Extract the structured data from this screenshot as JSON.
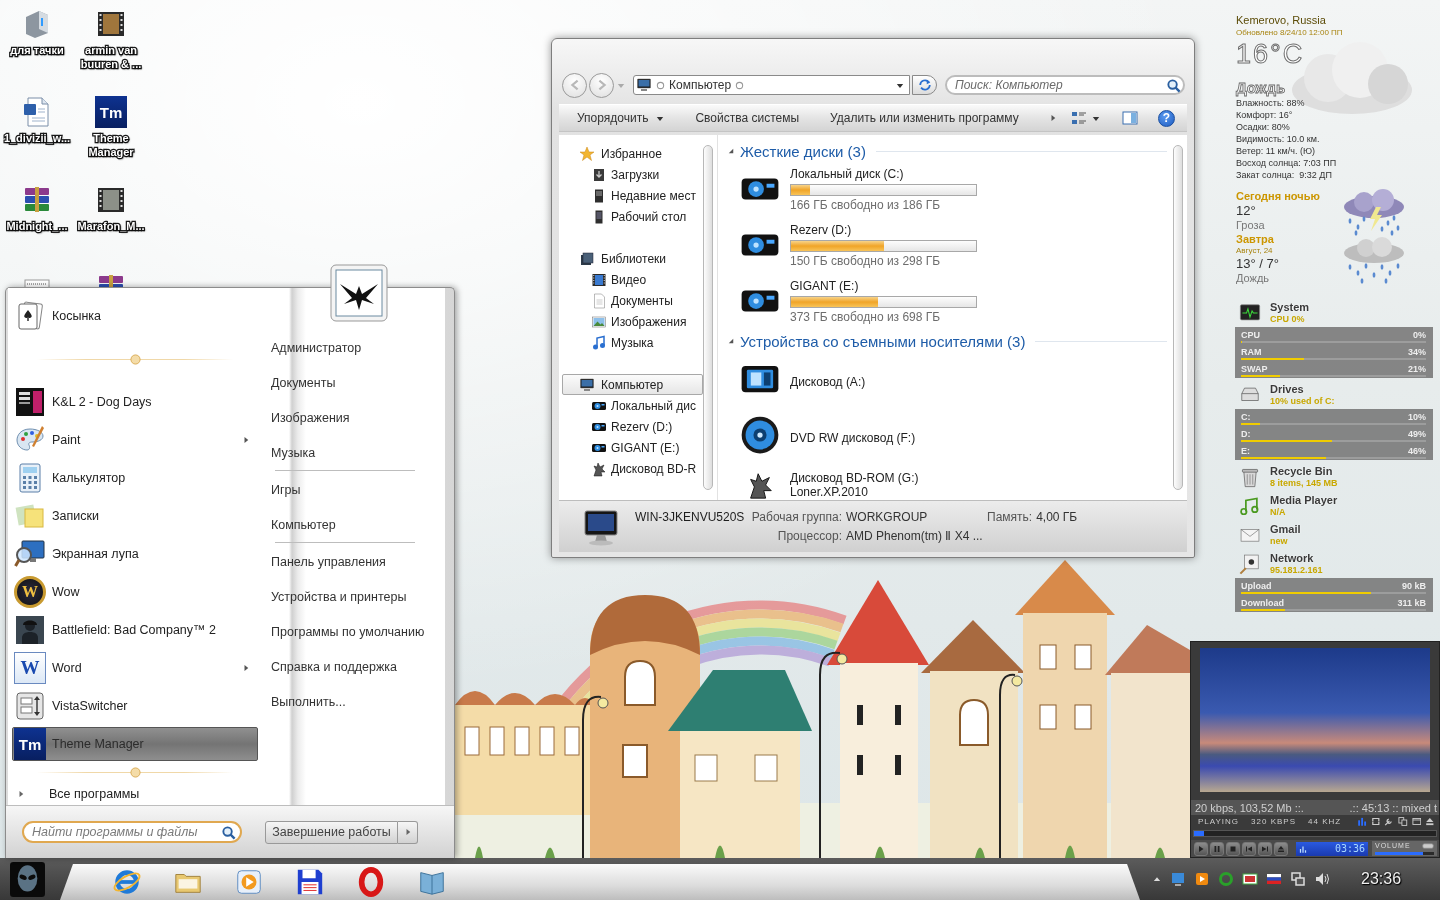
{
  "desktop_icons": [
    {
      "label": "для тачки",
      "kind": "device"
    },
    {
      "label": "1_divizii_w...",
      "kind": "document"
    },
    {
      "label": "Midnight_...",
      "kind": "archive"
    },
    {
      "kind": "textdoc"
    },
    {
      "label": "armin van buuren & ...",
      "kind": "film"
    },
    {
      "label": "Theme Manager",
      "kind": "tm",
      "icon_text": "Tm"
    },
    {
      "label": "Marafon_M...",
      "kind": "film2"
    },
    {
      "kind": "archive"
    }
  ],
  "start_menu": {
    "pinned": [
      {
        "label": "Косынка",
        "kind": "cards"
      }
    ],
    "recent": [
      {
        "label": "K&L 2 - Dog Days",
        "kind": "cover",
        "submenu": false,
        "selected": false
      },
      {
        "label": "Paint",
        "kind": "paint",
        "submenu": true,
        "selected": false
      },
      {
        "label": "Калькулятор",
        "kind": "calc",
        "submenu": false,
        "selected": false
      },
      {
        "label": "Записки",
        "kind": "notes",
        "submenu": false,
        "selected": false
      },
      {
        "label": "Экранная лупа",
        "kind": "magnifier",
        "submenu": false,
        "selected": false
      },
      {
        "label": "Wow",
        "kind": "wow",
        "icon_text": "W",
        "submenu": false,
        "selected": false
      },
      {
        "label": "Battlefield: Bad Company™ 2",
        "kind": "soldier",
        "submenu": false,
        "selected": false
      },
      {
        "label": "Word",
        "kind": "word",
        "icon_text": "W",
        "submenu": true,
        "selected": false
      },
      {
        "label": "VistaSwitcher",
        "kind": "switcher",
        "submenu": false,
        "selected": false
      },
      {
        "label": "Theme Manager",
        "kind": "tm",
        "icon_text": "Tm",
        "submenu": false,
        "selected": true
      }
    ],
    "all_programs": "Все программы",
    "search": {
      "placeholder": "Найти программы и файлы"
    },
    "shutdown": "Завершение работы",
    "places": [
      [
        "Администратор",
        "Документы",
        "Изображения",
        "Музыка"
      ],
      [
        "Игры",
        "Компьютер"
      ],
      [
        "Панель управления",
        "Устройства и принтеры",
        "Программы по умолчанию",
        "Справка и поддержка",
        "Выполнить..."
      ]
    ]
  },
  "explorer": {
    "address": "Компьютер",
    "search": {
      "placeholder": "Поиск: Компьютер"
    },
    "toolbar": [
      {
        "label": "Упорядочить",
        "dropdown": true
      },
      {
        "label": "Свойства системы",
        "dropdown": false
      },
      {
        "label": "Удалить или изменить программу",
        "dropdown": false
      }
    ],
    "help": "?",
    "nav": [
      {
        "label": "Избранное",
        "kind": "star",
        "selected": false,
        "children": [
          {
            "label": "Загрузки",
            "kind": "download",
            "selected": false
          },
          {
            "label": "Недавние мест",
            "kind": "recent",
            "selected": false
          },
          {
            "label": "Рабочий стол",
            "kind": "desktop",
            "selected": false
          }
        ]
      },
      {
        "label": "Библиотеки",
        "kind": "library",
        "selected": false,
        "children": [
          {
            "label": "Видео",
            "kind": "video",
            "selected": false
          },
          {
            "label": "Документы",
            "kind": "docs",
            "selected": false
          },
          {
            "label": "Изображения",
            "kind": "pictures",
            "selected": false
          },
          {
            "label": "Музыка",
            "kind": "music",
            "selected": false
          }
        ]
      },
      {
        "label": "Компьютер",
        "kind": "computer",
        "selected": true,
        "children": [
          {
            "label": "Локальный дис",
            "kind": "hdd",
            "selected": false
          },
          {
            "label": "Rezerv (D:)",
            "kind": "hdd",
            "selected": false
          },
          {
            "label": "GIGANT (E:)",
            "kind": "hdd",
            "selected": false
          },
          {
            "label": "Дисковод BD-R",
            "kind": "bd",
            "selected": false
          }
        ]
      }
    ],
    "groups": [
      {
        "title": "Жесткие диски (3)",
        "items": [
          {
            "name": "Локальный диск (C:)",
            "kind": "hdd",
            "level": 0.1,
            "free": "166 ГБ свободно из 186 ГБ"
          },
          {
            "name": "Rezerv (D:)",
            "kind": "hdd",
            "level": 0.5,
            "free": "150 ГБ свободно из 298 ГБ"
          },
          {
            "name": "GIGANT (E:)",
            "kind": "hdd",
            "level": 0.47,
            "free": "373 ГБ свободно из 698 ГБ"
          }
        ]
      },
      {
        "title": "Устройства со съемными носителями (3)",
        "items": [
          {
            "name": "Дисковод (A:)",
            "kind": "floppy"
          },
          {
            "name": "DVD RW дисковод (F:)",
            "kind": "dvd"
          },
          {
            "name": "Дисковод BD-ROM (G:)",
            "kind": "bd",
            "label": "Loner.XP.2010"
          }
        ]
      }
    ],
    "details": {
      "name": "WIN-3JKENVU520S",
      "fields": [
        {
          "key": "Рабочая группа:",
          "value": "WORKGROUP"
        },
        {
          "key": "Память:",
          "value": "4,00 ГБ"
        },
        {
          "key": "Процессор:",
          "value": "AMD Phenom(tm) Ⅱ X4 ..."
        }
      ]
    }
  },
  "weather": {
    "location": "Kemerovo, Russia",
    "updated": "Обновлено 8/24/10 12:00 ПП",
    "temperature": "16°C",
    "condition": "Дождь",
    "details": [
      "Влажность: 88%",
      "Комфорт: 16°",
      "Осадки: 80%",
      "Видимость: 10.0 км.",
      "Ветер: 11 км/ч. (Ю)",
      "Восход солнца: 7:03 ПП",
      "Закат солнца:  9:32 ДП"
    ],
    "forecast": [
      {
        "title": "Сегодня ночью",
        "temp": "12°",
        "condition": "Гроза",
        "kind": "storm"
      },
      {
        "title": "Завтра",
        "date": "Август, 24",
        "temp": "13° / 7°",
        "condition": "Дождь",
        "kind": "rain"
      }
    ]
  },
  "monitors": [
    {
      "title": "System",
      "summary": "CPU 0%",
      "kind": "system",
      "meters": [
        {
          "label": "CPU",
          "reading": "0%",
          "level": 0
        },
        {
          "label": "RAM",
          "reading": "34%",
          "level": 0.34
        },
        {
          "label": "SWAP",
          "reading": "21%",
          "level": 0.21
        }
      ]
    },
    {
      "title": "Drives",
      "summary": "10% used of C:",
      "kind": "drives",
      "meters": [
        {
          "label": "C:",
          "reading": "10%",
          "level": 0.1
        },
        {
          "label": "D:",
          "reading": "49%",
          "level": 0.49
        },
        {
          "label": "E:",
          "reading": "46%",
          "level": 0.46
        }
      ]
    },
    {
      "title": "Recycle Bin",
      "summary": "8 items, 145 MB",
      "kind": "bin"
    },
    {
      "title": "Media Player",
      "summary": "N/A",
      "kind": "player"
    },
    {
      "title": "Gmail",
      "summary": "new",
      "kind": "mail"
    },
    {
      "title": "Network",
      "summary": "95.181.2.161",
      "kind": "network",
      "meters": [
        {
          "label": "Upload",
          "reading": "90 kB",
          "level": 0.7
        },
        {
          "label": "Download",
          "reading": "311 kB",
          "level": 0.24
        }
      ]
    }
  ],
  "player": {
    "info_left": "20 kbps, 103,52 Mb ::.",
    "info_right": ".:: 45:13 :: mixed t",
    "status": [
      "PLAYING",
      "320 KBPS",
      "44 KHZ"
    ],
    "progress": {
      "level": 0.04
    },
    "time": "03:36",
    "volume_label": "VOLUME",
    "volume": {
      "level": 0.82
    }
  },
  "taskbar": {
    "clock": "23:36"
  }
}
